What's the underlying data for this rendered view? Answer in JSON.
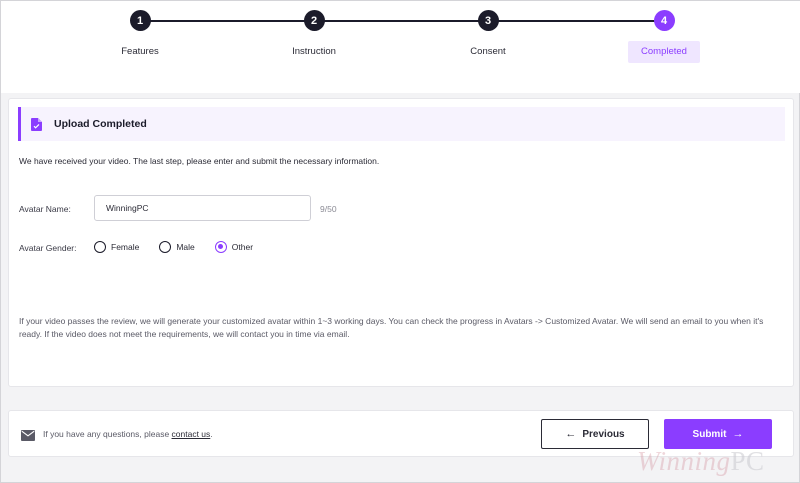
{
  "stepper": {
    "steps": [
      {
        "number": "1",
        "label": "Features"
      },
      {
        "number": "2",
        "label": "Instruction"
      },
      {
        "number": "3",
        "label": "Consent"
      },
      {
        "number": "4",
        "label": "Completed"
      }
    ],
    "active_step": 4
  },
  "banner": {
    "icon": "document-icon",
    "title": "Upload Completed"
  },
  "intro_text": "We have received your video. The last step, please enter and submit the necessary information.",
  "form": {
    "avatar_name_label": "Avatar Name:",
    "avatar_name_value": "WinningPC",
    "avatar_name_counter": "9/50",
    "avatar_gender_label": "Avatar Gender:",
    "gender_options": [
      {
        "label": "Female",
        "checked": false
      },
      {
        "label": "Male",
        "checked": false
      },
      {
        "label": "Other",
        "checked": true
      }
    ]
  },
  "note_text": "If your video passes the review, we will generate your customized avatar within 1~3 working days. You can check the progress in Avatars -> Customized Avatar. We will send an email to you when it's ready. If the video does not meet the requirements, we will contact you in time via email.",
  "footer": {
    "icon": "mail-icon",
    "help_prefix": "If you have any questions, please ",
    "help_link": "contact us",
    "help_suffix": ".",
    "previous_label": "Previous",
    "submit_label": "Submit"
  },
  "watermark": {
    "part1": "Winning",
    "part2": "PC"
  },
  "colors": {
    "accent": "#8b3dff",
    "dark": "#1b1b2a",
    "banner_bg": "#f7f3fe"
  }
}
